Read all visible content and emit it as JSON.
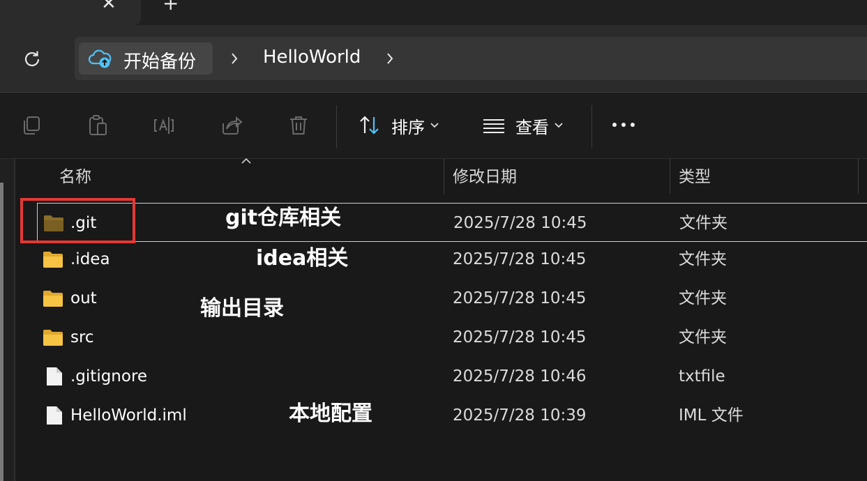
{
  "tabbar": {
    "close_glyph": "✕",
    "new_tab_glyph": "+"
  },
  "breadcrumb": {
    "root_label": "开始备份",
    "root_icon": "cloud-backup-icon",
    "current_label": "HelloWorld"
  },
  "toolbar": {
    "sort_label": "排序",
    "view_label": "查看",
    "icons": [
      "copy-icon",
      "paste-icon",
      "rename-icon",
      "share-icon",
      "delete-icon"
    ]
  },
  "columns": {
    "name": "名称",
    "modified": "修改日期",
    "type": "类型"
  },
  "files": [
    {
      "name": ".git",
      "modified": "2025/7/28 10:45",
      "type": "文件夹",
      "kind": "folder-dim"
    },
    {
      "name": ".idea",
      "modified": "2025/7/28 10:45",
      "type": "文件夹",
      "kind": "folder"
    },
    {
      "name": "out",
      "modified": "2025/7/28 10:45",
      "type": "文件夹",
      "kind": "folder"
    },
    {
      "name": "src",
      "modified": "2025/7/28 10:45",
      "type": "文件夹",
      "kind": "folder"
    },
    {
      "name": ".gitignore",
      "modified": "2025/7/28 10:46",
      "type": "txtfile",
      "kind": "file"
    },
    {
      "name": "HelloWorld.iml",
      "modified": "2025/7/28 10:39",
      "type": "IML 文件",
      "kind": "file"
    }
  ],
  "annotations": {
    "git": "git仓库相关",
    "idea": "idea相关",
    "out": "输出目录",
    "iml": "本地配置"
  },
  "colors": {
    "folder": "#f6c344",
    "folder_dim": "#8a6d2a",
    "highlight": "#e53935",
    "accent": "#4fc3f7"
  }
}
